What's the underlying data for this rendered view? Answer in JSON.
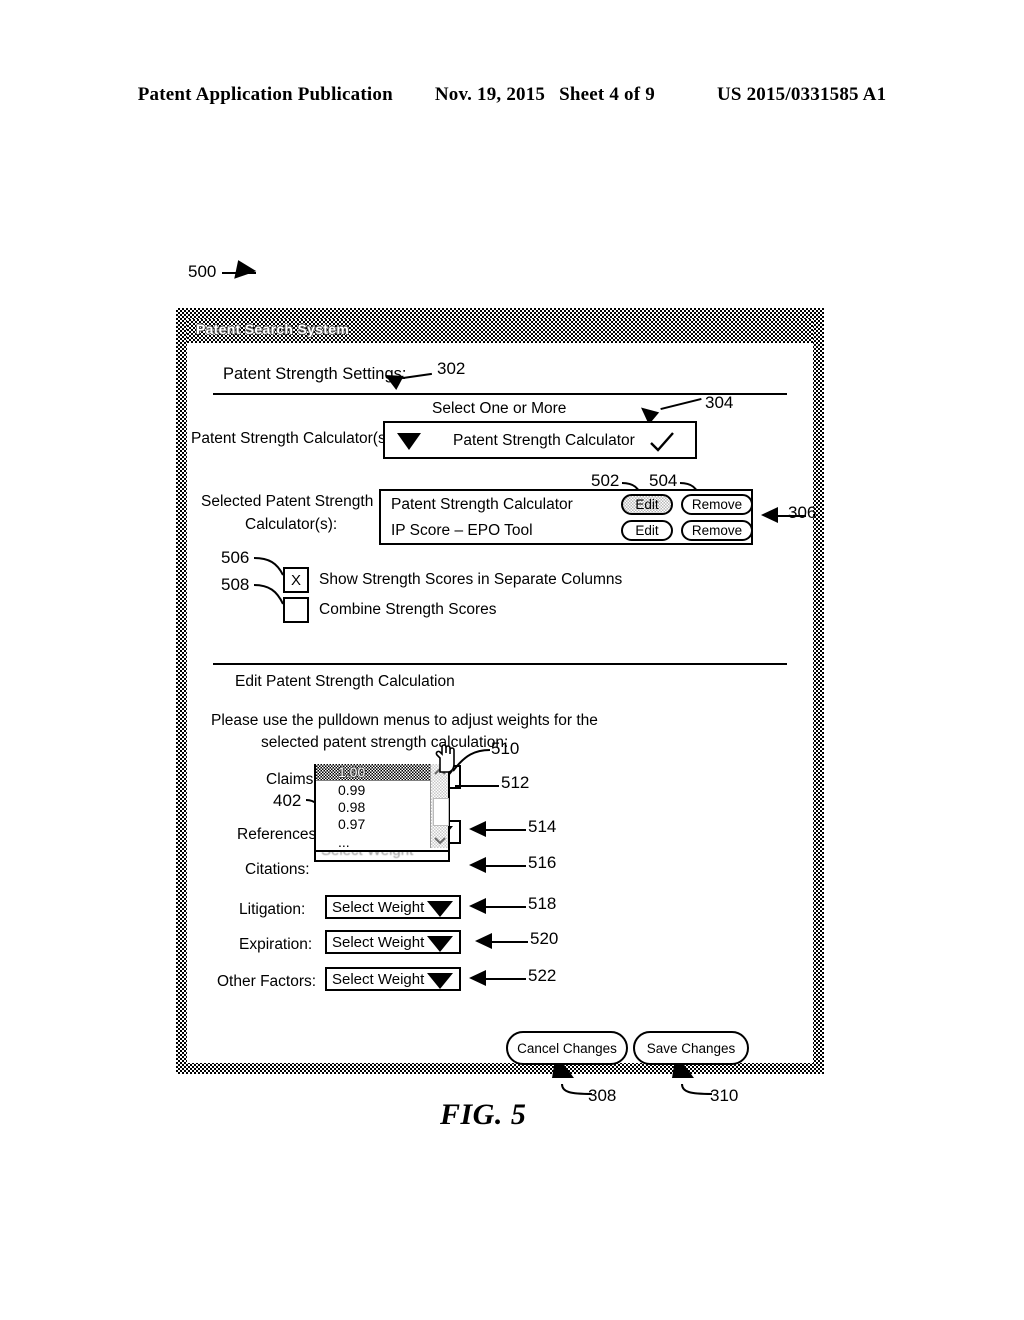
{
  "patent_header": {
    "publication": "Patent Application Publication",
    "date": "Nov. 19, 2015",
    "sheet": "Sheet 4 of 9",
    "number": "US 2015/0331585 A1"
  },
  "figure": {
    "caption": "FIG. 5",
    "lead_500": "500"
  },
  "window": {
    "title": "Patent Search System",
    "settings_heading": "Patent Strength Settings:",
    "ref_302": "302",
    "calculator_select": {
      "above_label": "Select One or More",
      "row_label": "Patent Strength Calculator(s):",
      "selected_value": "Patent Strength Calculator",
      "ref_304": "304"
    },
    "selected_calculators": {
      "label_line1": "Selected Patent Strength",
      "label_line2": "Calculator(s):",
      "ref_306": "306",
      "ref_502": "502",
      "ref_504": "504",
      "rows": [
        {
          "name": "Patent Strength Calculator",
          "edit_label": "Edit",
          "remove_label": "Remove",
          "edit_selected": true
        },
        {
          "name": "IP Score – EPO Tool",
          "edit_label": "Edit",
          "remove_label": "Remove",
          "edit_selected": false
        }
      ]
    },
    "checkboxes": [
      {
        "ref": "506",
        "mark": "X",
        "label": "Show Strength Scores in Separate Columns",
        "checked": true
      },
      {
        "ref": "508",
        "mark": "",
        "label": "Combine Strength Scores",
        "checked": false
      }
    ],
    "edit_section": {
      "heading": "Edit Patent Strength Calculation",
      "instruction_line1": "Please use the pulldown menus to adjust weights for the",
      "instruction_line2": "selected patent strength calculation:"
    },
    "weights": {
      "ref_402": "402",
      "default_value": "Select Weight",
      "rows": [
        {
          "label": "Claims:",
          "value": "Select Weight",
          "ref": "510",
          "open": true
        },
        {
          "label": "References:",
          "value": "Select Weight",
          "ref": "514",
          "open": false
        },
        {
          "label": "Citations:",
          "value": "Select Weight",
          "ref": "516",
          "open": false
        },
        {
          "label": "Litigation:",
          "value": "Select Weight",
          "ref": "518",
          "open": false
        },
        {
          "label": "Expiration:",
          "value": "Select Weight",
          "ref": "520",
          "open": false
        },
        {
          "label": "Other Factors:",
          "value": "Select Weight",
          "ref": "522",
          "open": false
        }
      ],
      "dropdown": {
        "ref_512": "512",
        "options": [
          "1.00",
          "0.99",
          "0.98",
          "0.97",
          "..."
        ],
        "highlighted_index": 0
      }
    },
    "actions": {
      "cancel_label": "Cancel Changes",
      "cancel_ref": "308",
      "save_label": "Save Changes",
      "save_ref": "310"
    }
  }
}
